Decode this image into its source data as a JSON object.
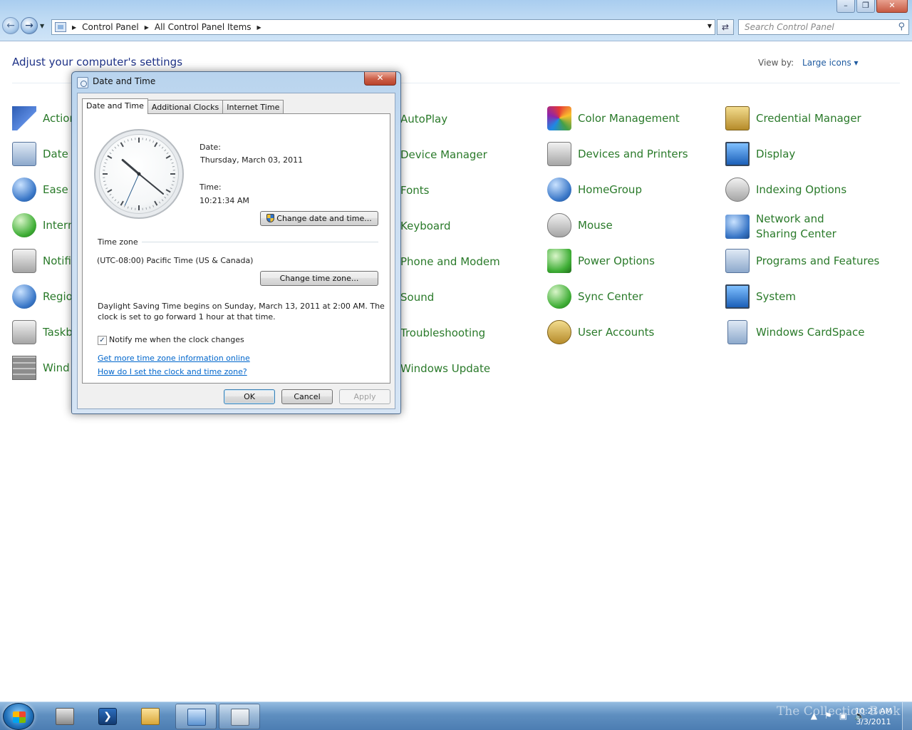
{
  "window": {
    "breadcrumb": [
      "Control Panel",
      "All Control Panel Items"
    ],
    "search_placeholder": "Search Control Panel",
    "buttons": [
      "minimize",
      "maximize",
      "close"
    ]
  },
  "control_panel": {
    "title": "Adjust your computer's settings",
    "view_by_label": "View by:",
    "view_by_value": "Large icons",
    "items": [
      {
        "label": "Action Center",
        "visible": "Action",
        "icon": "flag-icon"
      },
      {
        "label": "Date and Time",
        "visible": "Date a",
        "icon": "calendar-clock-icon"
      },
      {
        "label": "Ease of Access Center",
        "visible": "Ease o",
        "icon": "ease-of-access-icon"
      },
      {
        "label": "Internet Options",
        "visible": "Intern",
        "icon": "internet-options-icon"
      },
      {
        "label": "Notification Area Icons",
        "visible": "Notifi",
        "icon": "notification-area-icon"
      },
      {
        "label": "Region and Language",
        "visible": "Regio",
        "icon": "globe-clock-icon"
      },
      {
        "label": "Taskbar and Start Menu",
        "visible": "Taskb",
        "icon": "taskbar-icon"
      },
      {
        "label": "Windows Firewall",
        "visible": "Wind",
        "icon": "firewall-icon"
      },
      {
        "label": "AutoPlay",
        "icon": "autoplay-icon"
      },
      {
        "label": "Device Manager",
        "icon": "device-manager-icon"
      },
      {
        "label": "Fonts",
        "icon": "fonts-icon"
      },
      {
        "label": "Keyboard",
        "icon": "keyboard-icon"
      },
      {
        "label": "Phone and Modem",
        "icon": "phone-modem-icon"
      },
      {
        "label": "Sound",
        "icon": "sound-icon"
      },
      {
        "label": "Troubleshooting",
        "icon": "troubleshooting-icon"
      },
      {
        "label": "Windows Update",
        "icon": "windows-update-icon"
      },
      {
        "label": "Color Management",
        "icon": "color-management-icon"
      },
      {
        "label": "Devices and Printers",
        "icon": "printer-icon"
      },
      {
        "label": "HomeGroup",
        "icon": "homegroup-icon"
      },
      {
        "label": "Mouse",
        "icon": "mouse-icon"
      },
      {
        "label": "Power Options",
        "icon": "battery-icon"
      },
      {
        "label": "Sync Center",
        "icon": "sync-icon"
      },
      {
        "label": "User Accounts",
        "icon": "users-icon"
      },
      {
        "label": "Credential Manager",
        "icon": "vault-icon"
      },
      {
        "label": "Display",
        "icon": "display-icon"
      },
      {
        "label": "Indexing Options",
        "icon": "indexing-icon"
      },
      {
        "label": "Network and Sharing Center",
        "icon": "network-icon"
      },
      {
        "label": "Programs and Features",
        "icon": "programs-icon"
      },
      {
        "label": "System",
        "icon": "system-icon"
      },
      {
        "label": "Windows CardSpace",
        "icon": "cardspace-icon"
      }
    ]
  },
  "dialog": {
    "title": "Date and Time",
    "tabs": [
      "Date and Time",
      "Additional Clocks",
      "Internet Time"
    ],
    "active_tab": "Date and Time",
    "date_label": "Date:",
    "date_value": "Thursday, March 03, 2011",
    "time_label": "Time:",
    "time_value": "10:21:34 AM",
    "change_datetime_button": "Change date and time...",
    "timezone_heading": "Time zone",
    "timezone_value": "(UTC-08:00) Pacific Time (US & Canada)",
    "change_timezone_button": "Change time zone...",
    "dst_text_line1": "Daylight Saving Time begins on Sunday, March 13, 2011 at 2:00 AM. The",
    "dst_text_line2": "clock is set to go forward 1 hour at that time.",
    "notify_label": "Notify me when the clock changes",
    "notify_checked": true,
    "link_more_info": "Get more time zone information online",
    "link_how_to": "How do I set the clock and time zone?",
    "ok": "OK",
    "cancel": "Cancel",
    "apply": "Apply",
    "clock": {
      "hours": 10,
      "minutes": 21,
      "seconds": 34
    }
  },
  "taskbar": {
    "clock_time": "10:21 AM",
    "clock_date": "3/3/2011",
    "watermark": "The Collection Book"
  }
}
